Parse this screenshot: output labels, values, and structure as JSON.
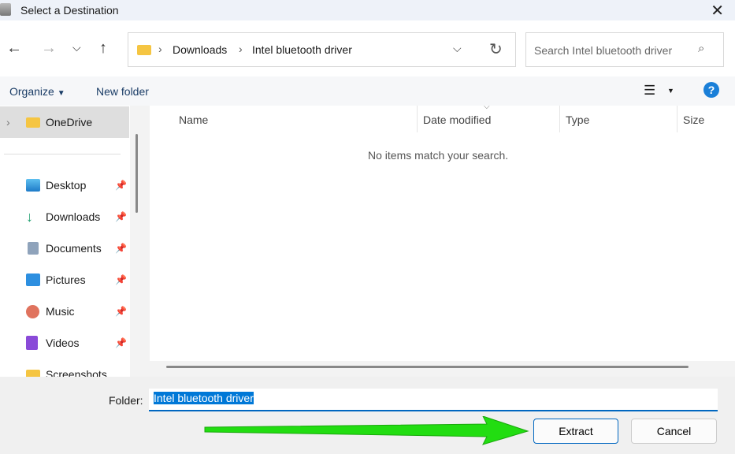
{
  "window": {
    "title": "Select a Destination"
  },
  "address": {
    "crumbs": [
      "Downloads",
      "Intel bluetooth driver"
    ]
  },
  "search": {
    "placeholder": "Search Intel bluetooth driver"
  },
  "toolbar": {
    "organize": "Organize",
    "new_folder": "New folder"
  },
  "sidebar": {
    "items": [
      {
        "label": "OneDrive",
        "icon": "folder-icon"
      },
      {
        "label": "Desktop",
        "icon": "desktop-icon"
      },
      {
        "label": "Downloads",
        "icon": "download-icon"
      },
      {
        "label": "Documents",
        "icon": "document-icon"
      },
      {
        "label": "Pictures",
        "icon": "pictures-icon"
      },
      {
        "label": "Music",
        "icon": "music-icon"
      },
      {
        "label": "Videos",
        "icon": "videos-icon"
      },
      {
        "label": "Screenshots",
        "icon": "folder-icon"
      }
    ]
  },
  "list": {
    "columns": [
      "Name",
      "Date modified",
      "Type",
      "Size"
    ],
    "empty_message": "No items match your search."
  },
  "footer": {
    "folder_label": "Folder:",
    "folder_value": "Intel bluetooth driver",
    "extract": "Extract",
    "cancel": "Cancel"
  },
  "colors": {
    "accent": "#0067c0",
    "arrow": "#22dd11"
  }
}
